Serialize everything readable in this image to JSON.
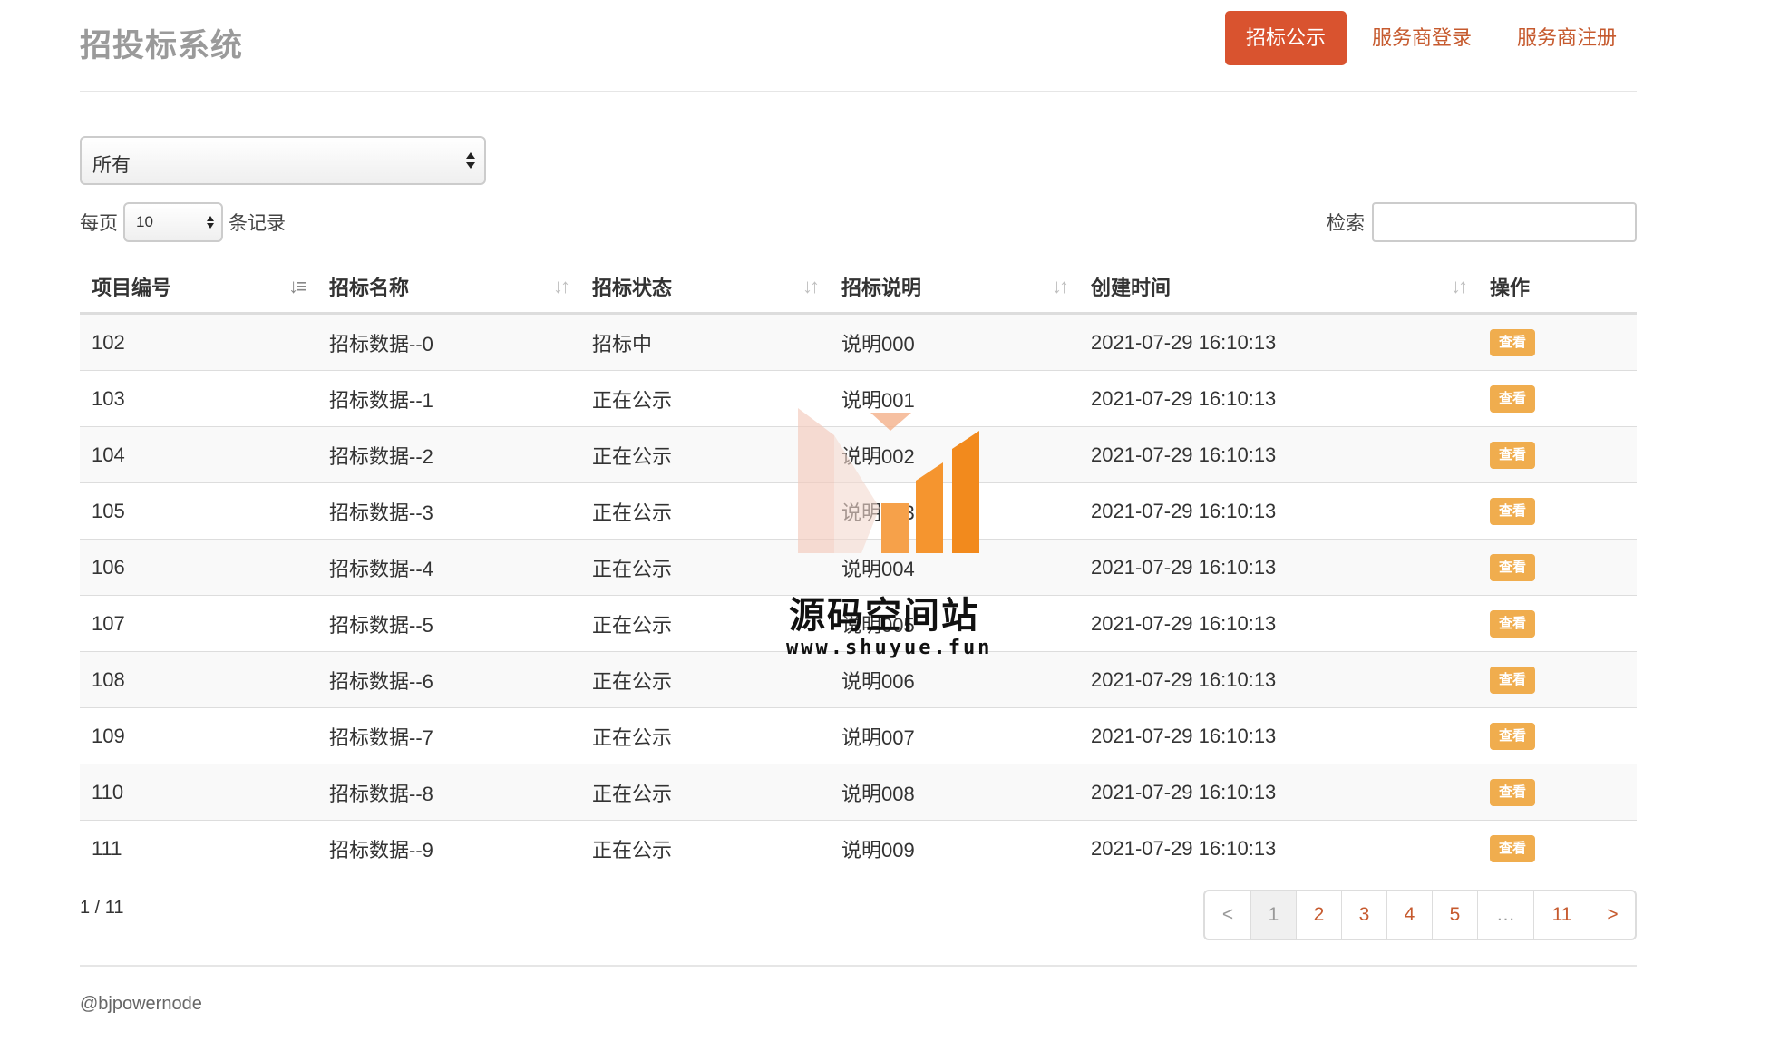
{
  "header": {
    "brand": "招投标系统",
    "nav": [
      {
        "label": "招标公示",
        "active": true
      },
      {
        "label": "服务商登录",
        "active": false
      },
      {
        "label": "服务商注册",
        "active": false
      }
    ]
  },
  "filter": {
    "selected": "所有"
  },
  "length": {
    "prefix": "每页",
    "selected": "10",
    "suffix": "条记录"
  },
  "search": {
    "label": "检索",
    "value": ""
  },
  "table": {
    "columns": [
      "项目编号",
      "招标名称",
      "招标状态",
      "招标说明",
      "创建时间",
      "操作"
    ],
    "rows": [
      {
        "id": "102",
        "name": "招标数据--0",
        "status": "招标中",
        "desc": "说明000",
        "created": "2021-07-29 16:10:13",
        "action": "查看"
      },
      {
        "id": "103",
        "name": "招标数据--1",
        "status": "正在公示",
        "desc": "说明001",
        "created": "2021-07-29 16:10:13",
        "action": "查看"
      },
      {
        "id": "104",
        "name": "招标数据--2",
        "status": "正在公示",
        "desc": "说明002",
        "created": "2021-07-29 16:10:13",
        "action": "查看"
      },
      {
        "id": "105",
        "name": "招标数据--3",
        "status": "正在公示",
        "desc": "说明003",
        "created": "2021-07-29 16:10:13",
        "action": "查看"
      },
      {
        "id": "106",
        "name": "招标数据--4",
        "status": "正在公示",
        "desc": "说明004",
        "created": "2021-07-29 16:10:13",
        "action": "查看"
      },
      {
        "id": "107",
        "name": "招标数据--5",
        "status": "正在公示",
        "desc": "说明005",
        "created": "2021-07-29 16:10:13",
        "action": "查看"
      },
      {
        "id": "108",
        "name": "招标数据--6",
        "status": "正在公示",
        "desc": "说明006",
        "created": "2021-07-29 16:10:13",
        "action": "查看"
      },
      {
        "id": "109",
        "name": "招标数据--7",
        "status": "正在公示",
        "desc": "说明007",
        "created": "2021-07-29 16:10:13",
        "action": "查看"
      },
      {
        "id": "110",
        "name": "招标数据--8",
        "status": "正在公示",
        "desc": "说明008",
        "created": "2021-07-29 16:10:13",
        "action": "查看"
      },
      {
        "id": "111",
        "name": "招标数据--9",
        "status": "正在公示",
        "desc": "说明009",
        "created": "2021-07-29 16:10:13",
        "action": "查看"
      }
    ]
  },
  "info": "1 / 11",
  "pagination": [
    "<",
    "1",
    "2",
    "3",
    "4",
    "5",
    "…",
    "11",
    ">"
  ],
  "pagination_current": "1",
  "footer": "@bjpowernode",
  "watermark": {
    "title": "源码空间站",
    "url": "www.shuyue.fun"
  },
  "colors": {
    "accent": "#d9532f",
    "link": "#c65a2e",
    "warning_button": "#f0ad4e"
  },
  "icons": {
    "sort_active": "sort-numeric-asc-icon",
    "sort": "sort-both-icon",
    "select_arrows": "updown-arrows-icon"
  }
}
